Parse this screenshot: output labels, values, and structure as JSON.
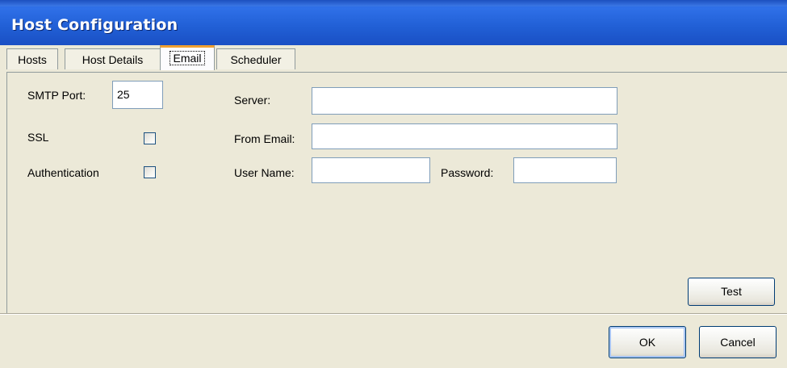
{
  "window": {
    "title": "Host Configuration"
  },
  "tabs": [
    {
      "label": "Hosts"
    },
    {
      "label": "Host Details"
    },
    {
      "label": "Email",
      "active": true
    },
    {
      "label": "Scheduler"
    }
  ],
  "email": {
    "smtp_port_label": "SMTP Port:",
    "smtp_port_value": "25",
    "ssl_label": "SSL",
    "ssl_checked": false,
    "authentication_label": "Authentication",
    "authentication_checked": false,
    "server_label": "Server:",
    "server_value": "",
    "from_email_label": "From Email:",
    "from_email_value": "",
    "user_name_label": "User Name:",
    "user_name_value": "",
    "password_label": "Password:",
    "password_value": "",
    "test_button": "Test"
  },
  "footer": {
    "ok_button": "OK",
    "cancel_button": "Cancel"
  },
  "colors": {
    "titlebar": "#215fd5",
    "dialog_bg": "#ECE9D8",
    "active_tab_highlight": "#F0A030",
    "input_border": "#7F9DB9"
  }
}
